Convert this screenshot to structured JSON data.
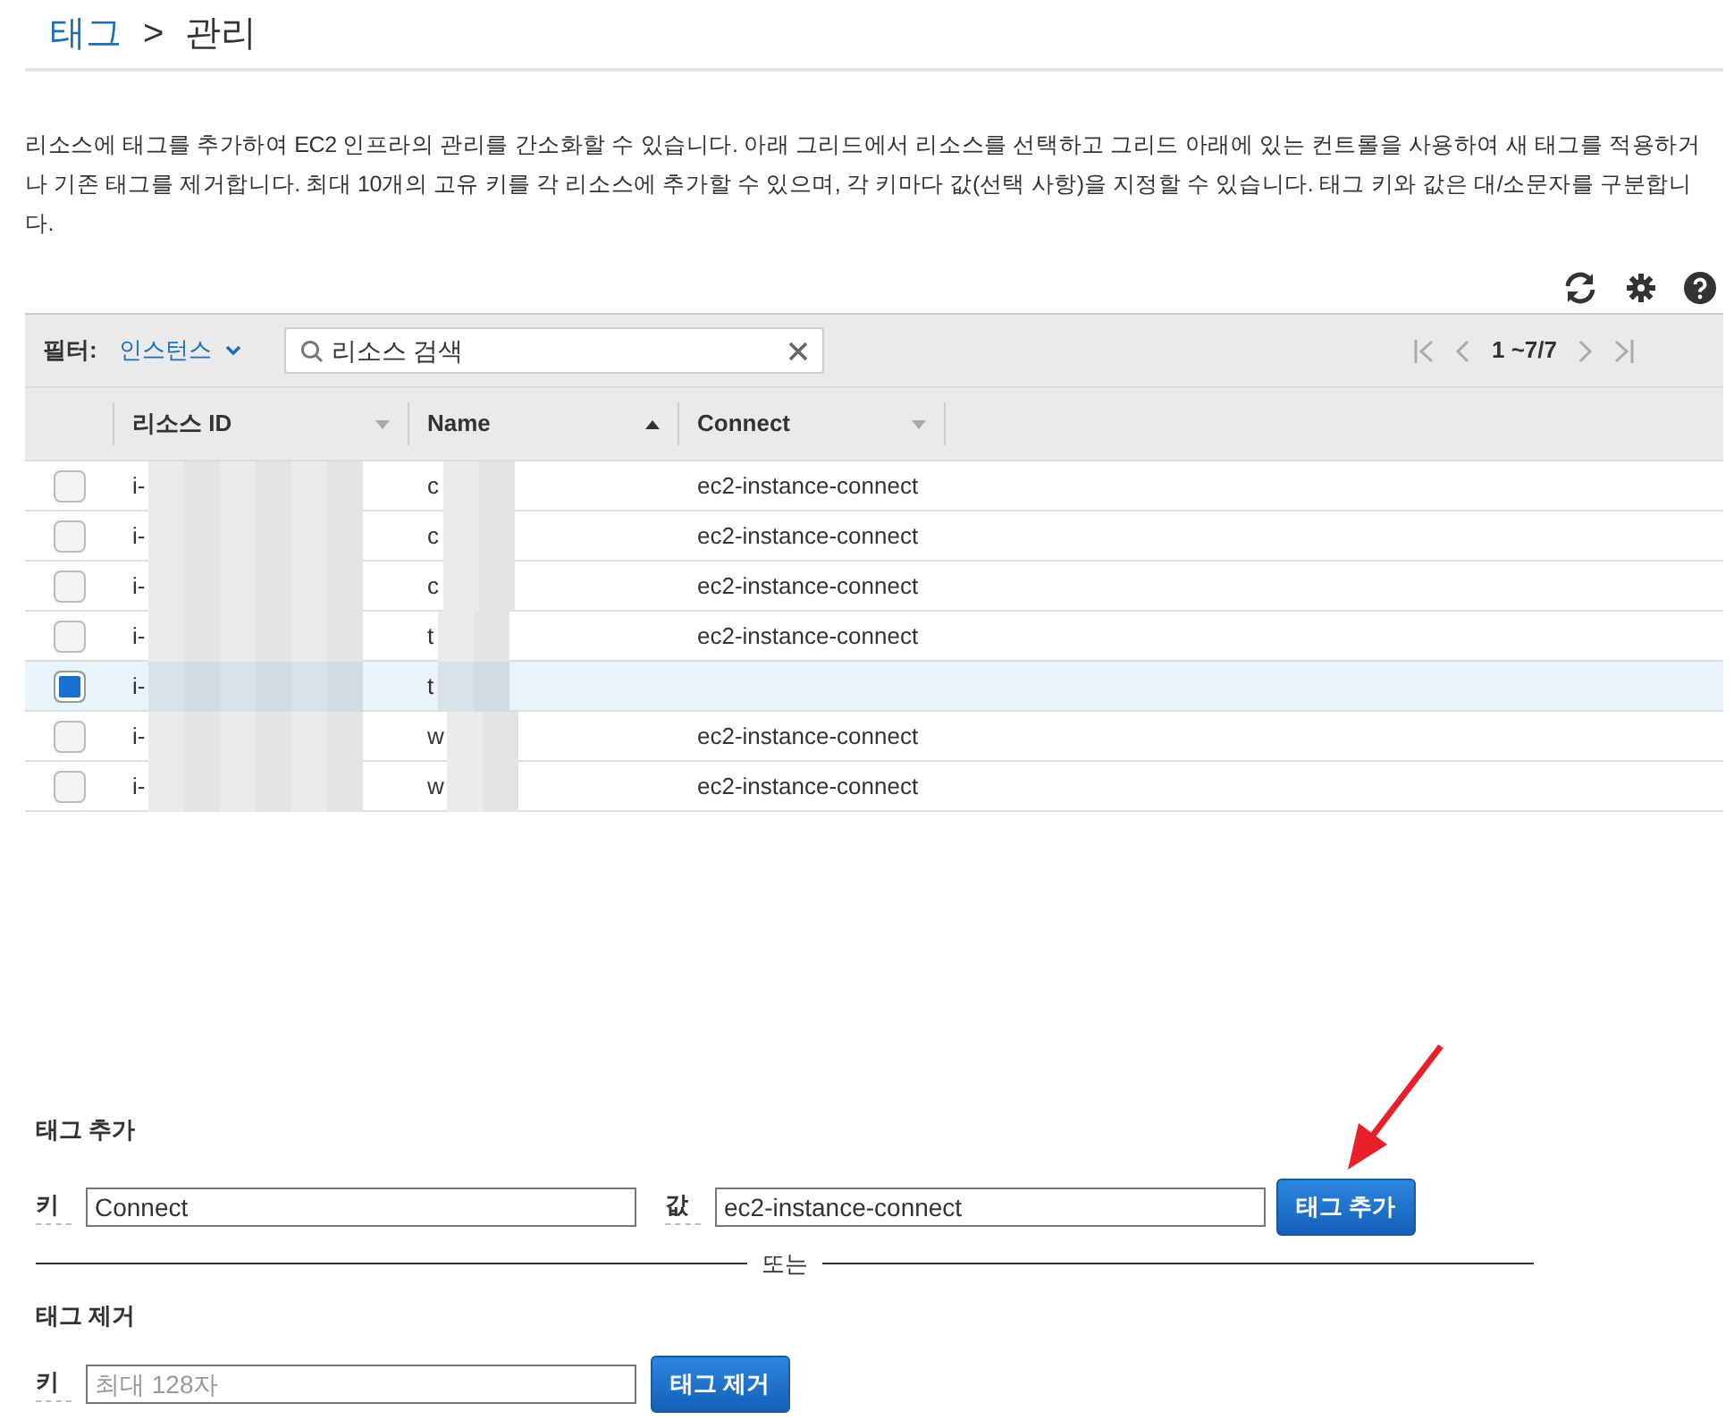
{
  "breadcrumb": {
    "parent": "태그",
    "separator": ">",
    "current": "관리"
  },
  "description": "리소스에 태그를 추가하여 EC2 인프라의 관리를 간소화할 수 있습니다. 아래 그리드에서 리소스를 선택하고 그리드 아래에 있는 컨트롤을 사용하여 새 태그를 적용하거나 기존 태그를 제거합니다. 최대 10개의 고유 키를 각 리소스에 추가할 수 있으며, 각 키마다 값(선택 사항)을 지정할 수 있습니다. 태그 키와 값은 대/소문자를 구분합니다.",
  "toolbar": {
    "filter_label": "필터:",
    "filter_value": "인스턴스",
    "search": {
      "value": "리소스 검색"
    },
    "pagination": "1 ~7/7"
  },
  "table": {
    "columns": [
      {
        "label": "리소스 ID",
        "sorted": false
      },
      {
        "label": "Name",
        "sorted": true
      },
      {
        "label": "Connect",
        "sorted": false
      }
    ],
    "rows": [
      {
        "id": "i-",
        "name": "c",
        "connect": "ec2-instance-connect",
        "selected": false
      },
      {
        "id": "i-",
        "name": "c",
        "connect": "ec2-instance-connect",
        "selected": false
      },
      {
        "id": "i-",
        "name": "c",
        "connect": "ec2-instance-connect",
        "selected": false
      },
      {
        "id": "i-",
        "name": "t",
        "connect": "ec2-instance-connect",
        "selected": false
      },
      {
        "id": "i-",
        "name": "t",
        "selected": true
      },
      {
        "id": "i-",
        "name": "w",
        "connect": "ec2-instance-connect",
        "selected": false
      },
      {
        "id": "i-",
        "name": "w",
        "connect": "ec2-instance-connect",
        "selected": false
      }
    ]
  },
  "add_tag": {
    "title": "태그 추가",
    "key_label": "키",
    "key_value": "Connect",
    "value_label": "값",
    "value_value": "ec2-instance-connect",
    "button": "태그 추가"
  },
  "divider_text": "또는",
  "remove_tag": {
    "title": "태그 제거",
    "key_label": "키",
    "key_placeholder": "최대 128자",
    "button": "태그 제거"
  }
}
